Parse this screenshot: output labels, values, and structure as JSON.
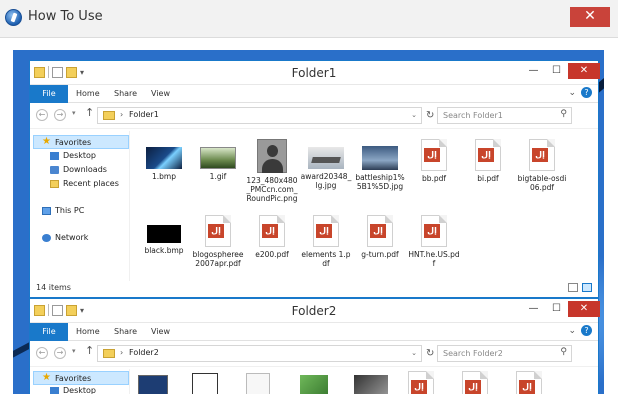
{
  "outer_window": {
    "title": "How To Use",
    "close_glyph": "✕"
  },
  "folder1": {
    "window_title": "Folder1",
    "ribbon_tabs": [
      "File",
      "Home",
      "Share",
      "View"
    ],
    "address_path": "Folder1",
    "search_placeholder": "Search Folder1",
    "nav": {
      "favorites": "Favorites",
      "desktop": "Desktop",
      "downloads": "Downloads",
      "recent": "Recent places",
      "thispc": "This PC",
      "network": "Network"
    },
    "files": [
      {
        "name": "1.bmp",
        "kind": "image-space"
      },
      {
        "name": "1.gif",
        "kind": "image-gif"
      },
      {
        "name": "123_480x480_PMCcn.com_RoundPic.png",
        "kind": "image-person"
      },
      {
        "name": "award20348_lg.jpg",
        "kind": "image-ship"
      },
      {
        "name": "battleship1%5B1%5D.jpg",
        "kind": "image-ship2"
      },
      {
        "name": "bb.pdf",
        "kind": "pdf"
      },
      {
        "name": "bi.pdf",
        "kind": "pdf"
      },
      {
        "name": "bigtable-osdi06.pdf",
        "kind": "pdf"
      },
      {
        "name": "black.bmp",
        "kind": "image-black"
      },
      {
        "name": "blogospheree2007apr.pdf",
        "kind": "pdf"
      },
      {
        "name": "e200.pdf",
        "kind": "pdf"
      },
      {
        "name": "elements 1.pdf",
        "kind": "pdf"
      },
      {
        "name": "g-turn.pdf",
        "kind": "pdf"
      },
      {
        "name": "HNT.he.US.pdf",
        "kind": "pdf"
      }
    ],
    "item_count": "14 items"
  },
  "folder2": {
    "window_title": "Folder2",
    "ribbon_tabs": [
      "File",
      "Home",
      "Share",
      "View"
    ],
    "address_path": "Folder2",
    "search_placeholder": "Search Folder2",
    "nav": {
      "favorites": "Favorites",
      "desktop": "Desktop"
    }
  },
  "pdf_badge": "إل",
  "colors": {
    "accent": "#1979ca",
    "close": "#c7362b",
    "desktop": "#2a6fc9",
    "pdf_badge": "#c8452b"
  }
}
